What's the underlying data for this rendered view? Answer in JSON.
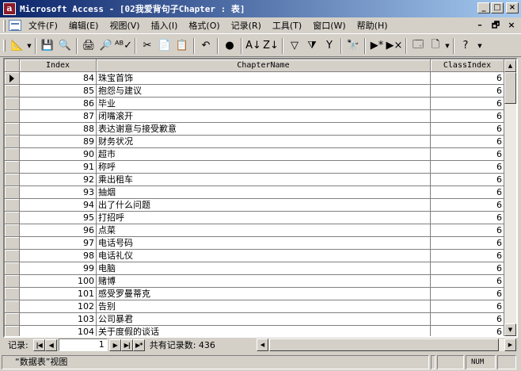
{
  "window": {
    "app_icon_letter": "a",
    "title": "Microsoft Access - [02我爱背句子Chapter : 表]",
    "minimize": "_",
    "maximize": "□",
    "close": "×"
  },
  "menu": {
    "items": [
      "文件(F)",
      "编辑(E)",
      "视图(V)",
      "插入(I)",
      "格式(O)",
      "记录(R)",
      "工具(T)",
      "窗口(W)",
      "帮助(H)"
    ],
    "mdi_min": "–",
    "mdi_restore": "🗗",
    "mdi_close": "×"
  },
  "toolbar": {
    "icons": {
      "view": "📐",
      "save": "💾",
      "search": "🔍",
      "print": "🖨",
      "preview": "🔎",
      "spell": "ᴬᴮ✓",
      "cut": "✂",
      "copy": "📄",
      "paste": "📋",
      "undo": "↶",
      "hyperlink": "●",
      "sort_asc": "A↓",
      "sort_desc": "Z↓",
      "filter_sel": "▽",
      "filter_form": "⧩",
      "filter_apply": "Y",
      "find": "🔭",
      "new_rec": "▶*",
      "del_rec": "▶×",
      "db_window": "🗔",
      "new_obj": "🗋",
      "help": "?"
    }
  },
  "grid": {
    "columns": [
      "Index",
      "ChapterName",
      "ClassIndex"
    ],
    "rows": [
      {
        "index": "84",
        "name": "珠宝首饰",
        "class": "6"
      },
      {
        "index": "85",
        "name": "抱怨与建议",
        "class": "6"
      },
      {
        "index": "86",
        "name": "毕业",
        "class": "6"
      },
      {
        "index": "87",
        "name": "闭嘴滚开",
        "class": "6"
      },
      {
        "index": "88",
        "name": "表达谢意与接受歉意",
        "class": "6"
      },
      {
        "index": "89",
        "name": "财务状况",
        "class": "6"
      },
      {
        "index": "90",
        "name": "超市",
        "class": "6"
      },
      {
        "index": "91",
        "name": "称呼",
        "class": "6"
      },
      {
        "index": "92",
        "name": "乘出租车",
        "class": "6"
      },
      {
        "index": "93",
        "name": "抽烟",
        "class": "6"
      },
      {
        "index": "94",
        "name": "出了什么问题",
        "class": "6"
      },
      {
        "index": "95",
        "name": "打招呼",
        "class": "6"
      },
      {
        "index": "96",
        "name": "点菜",
        "class": "6"
      },
      {
        "index": "97",
        "name": "电话号码",
        "class": "6"
      },
      {
        "index": "98",
        "name": "电话礼仪",
        "class": "6"
      },
      {
        "index": "99",
        "name": "电脑",
        "class": "6"
      },
      {
        "index": "100",
        "name": "赌博",
        "class": "6"
      },
      {
        "index": "101",
        "name": "感受罗曼蒂克",
        "class": "6"
      },
      {
        "index": "102",
        "name": "告别",
        "class": "6"
      },
      {
        "index": "103",
        "name": "公司暴君",
        "class": "6"
      },
      {
        "index": "104",
        "name": "关于度假的谈话",
        "class": "6"
      }
    ]
  },
  "navigator": {
    "label": "记录:",
    "first": "|◀",
    "prev": "◀",
    "current": "1",
    "next": "▶",
    "last": "▶|",
    "new": "▶*",
    "total": "共有记录数: 436"
  },
  "status": {
    "view": "“数据表”视图",
    "num": "NUM"
  }
}
